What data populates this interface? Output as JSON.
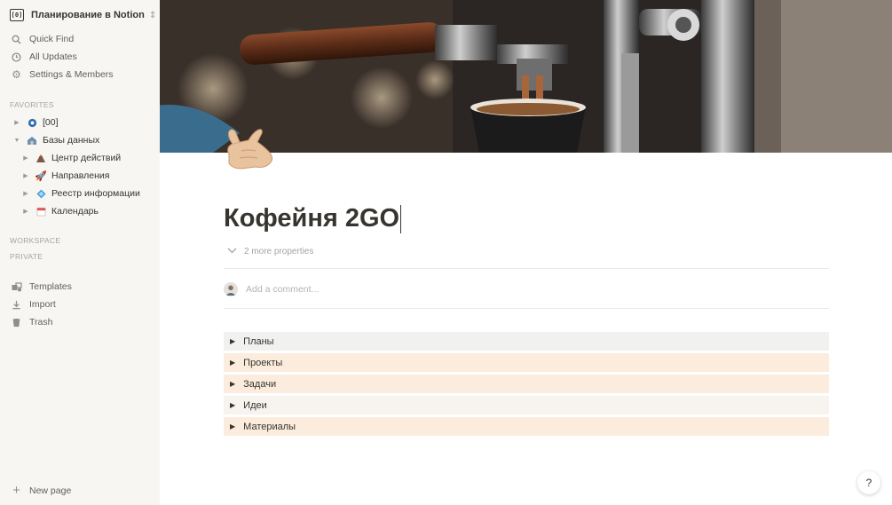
{
  "workspace": {
    "name": "Планирование в Notion",
    "icon_text": "[0]"
  },
  "nav": [
    {
      "label": "Quick Find",
      "icon": "search-icon"
    },
    {
      "label": "All Updates",
      "icon": "clock-icon"
    },
    {
      "label": "Settings & Members",
      "icon": "gear-icon"
    }
  ],
  "sections": {
    "favorites": "FAVORITES",
    "workspace": "WORKSPACE",
    "private": "PRIVATE"
  },
  "favorites": [
    {
      "label": "[00]",
      "icon": "blue-circle-icon",
      "expanded": false
    },
    {
      "label": "Базы данных",
      "icon": "house-icon",
      "expanded": true,
      "children": [
        {
          "label": "Центр действий",
          "icon": "volcano-icon"
        },
        {
          "label": "Направления",
          "icon": "rocket-icon"
        },
        {
          "label": "Реестр информации",
          "icon": "diamond-icon"
        },
        {
          "label": "Календарь",
          "icon": "calendar-icon"
        }
      ]
    }
  ],
  "tools": [
    {
      "label": "Templates",
      "icon": "templates-icon"
    },
    {
      "label": "Import",
      "icon": "import-icon"
    },
    {
      "label": "Trash",
      "icon": "trash-icon"
    }
  ],
  "new_page": "New page",
  "page": {
    "title": "Кофейня 2GO",
    "icon": "call-me-hand-icon",
    "more_properties": "2 more properties",
    "comment_placeholder": "Add a comment..."
  },
  "toggles": [
    {
      "label": "Планы",
      "color": "#f1f1ef"
    },
    {
      "label": "Проекты",
      "color": "#fbecdd"
    },
    {
      "label": "Задачи",
      "color": "#fbecdd"
    },
    {
      "label": "Идеи",
      "color": "#f7f3ee"
    },
    {
      "label": "Материалы",
      "color": "#fbecdd"
    }
  ],
  "help_label": "?"
}
